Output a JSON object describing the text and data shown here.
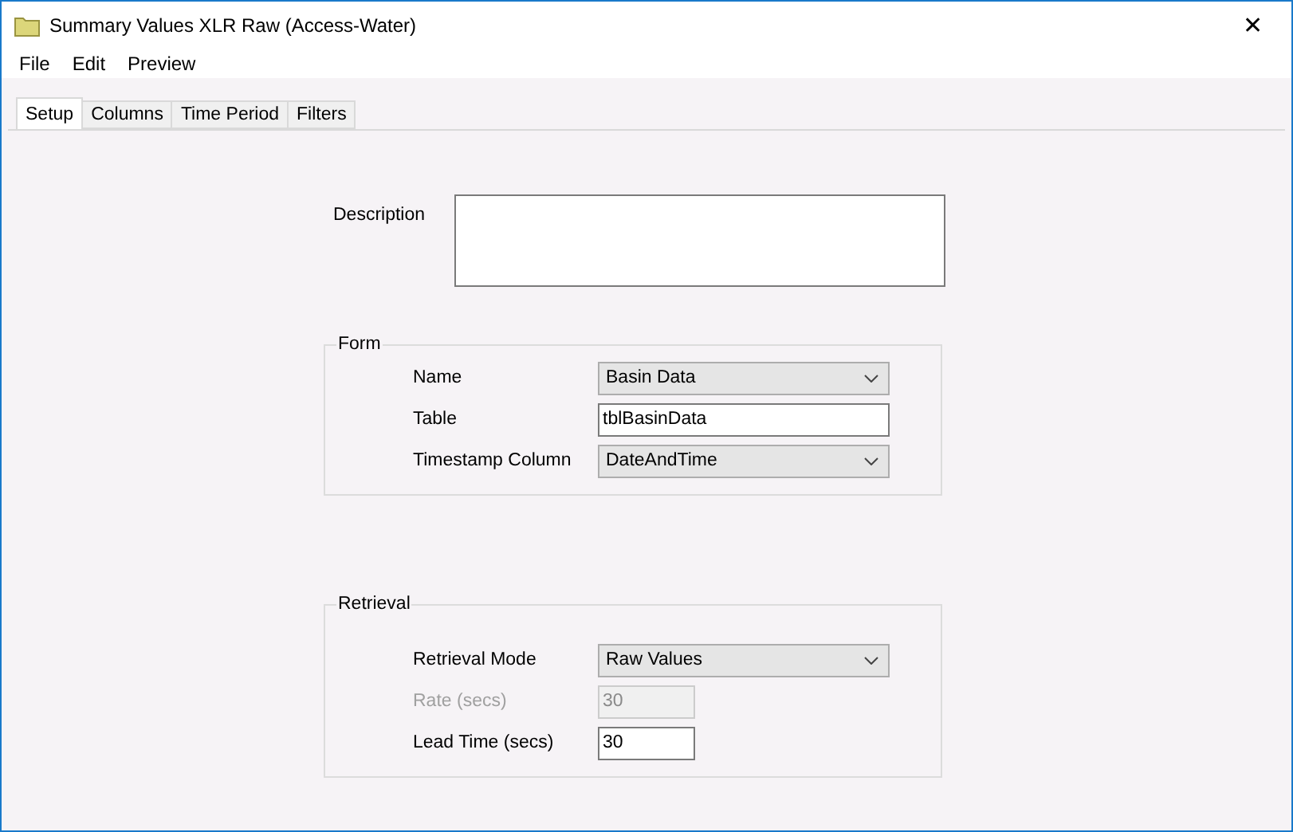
{
  "window": {
    "title": "Summary Values XLR Raw (Access-Water)",
    "close": "✕"
  },
  "menu": [
    "File",
    "Edit",
    "Preview"
  ],
  "tabs": [
    {
      "label": "Setup",
      "selected": true
    },
    {
      "label": "Columns",
      "selected": false
    },
    {
      "label": "Time Period",
      "selected": false
    },
    {
      "label": "Filters",
      "selected": false
    }
  ],
  "description": {
    "label": "Description"
  },
  "groups": [
    {
      "title": "Form",
      "fields": [
        {
          "kind": "dropdown",
          "label": "Name",
          "value": "Basin Data",
          "disabled": false
        },
        {
          "kind": "text",
          "label": "Table",
          "value": "tblBasinData",
          "disabled": false
        },
        {
          "kind": "dropdown",
          "label": "Timestamp Column",
          "value": "DateAndTime",
          "disabled": false
        }
      ]
    },
    {
      "title": "Retrieval",
      "fields": [
        {
          "kind": "dropdown",
          "label": "Retrieval Mode",
          "value": "Raw Values",
          "disabled": false
        },
        {
          "kind": "short",
          "label": "Rate (secs)",
          "value": "30",
          "disabled": true
        },
        {
          "kind": "short",
          "label": "Lead Time (secs)",
          "value": "30",
          "disabled": false
        }
      ]
    }
  ]
}
